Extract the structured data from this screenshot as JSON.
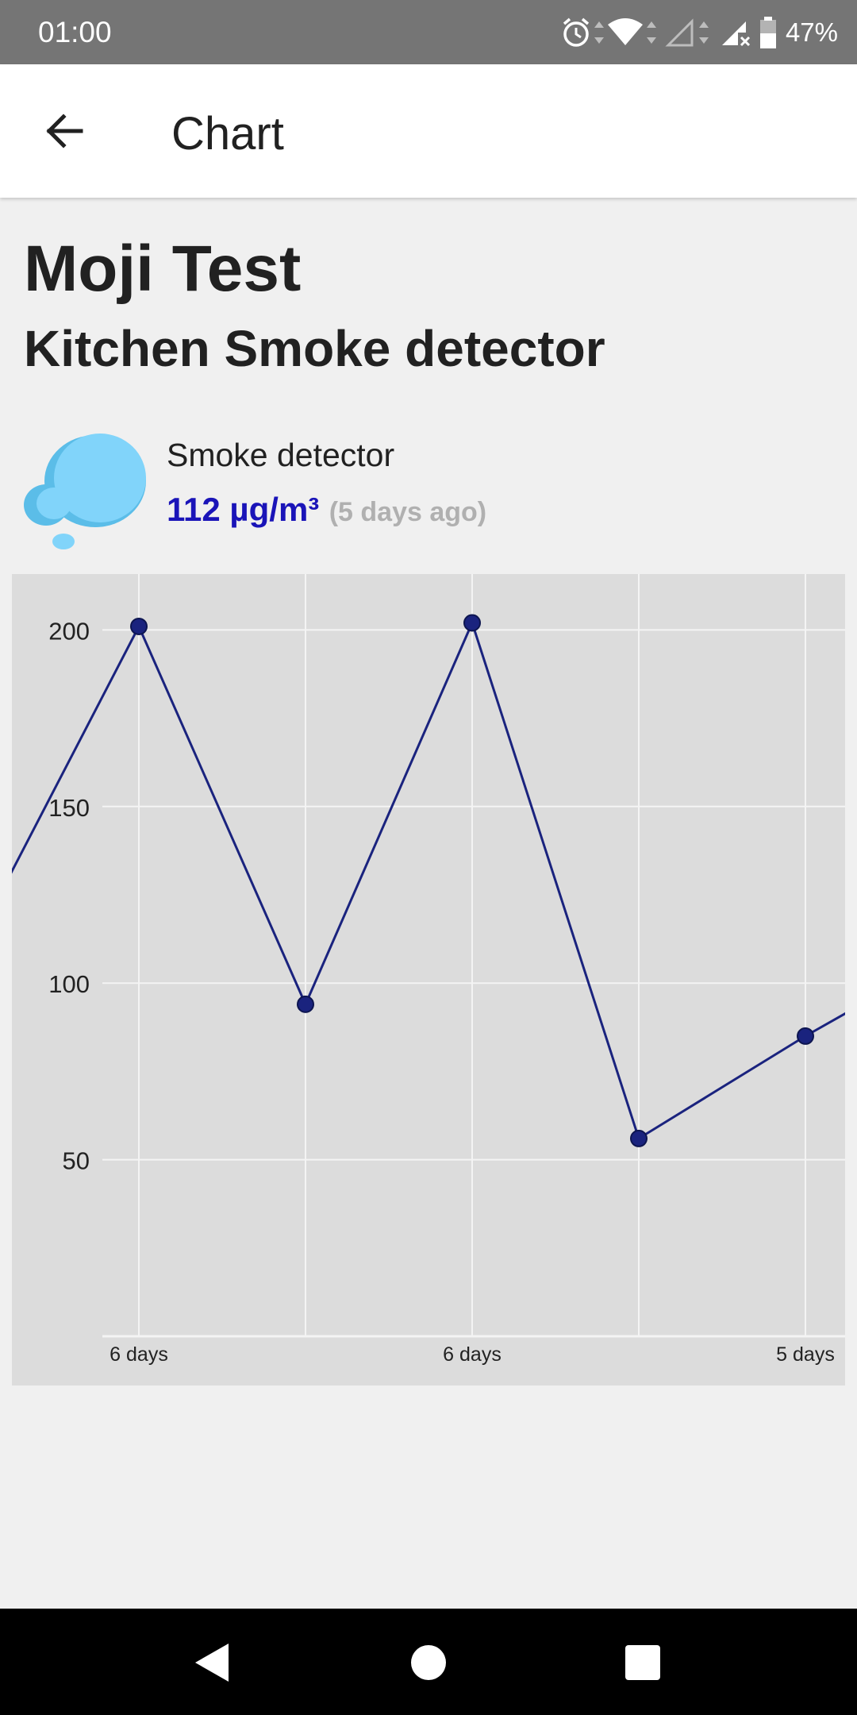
{
  "status_bar": {
    "time": "01:00",
    "battery": "47%"
  },
  "app_bar": {
    "title": "Chart",
    "back_icon": "arrow-back-icon"
  },
  "header": {
    "device": "Moji Test",
    "sensor": "Kitchen Smoke detector"
  },
  "sensor": {
    "icon": "cloud-bubble-icon",
    "type": "Smoke detector",
    "value": "112 µg/m³",
    "age": "(5 days ago)"
  },
  "colors": {
    "accent": "#1a14b8",
    "series": "#1a237e",
    "chart_bg": "#dcdcdc",
    "icon": "#7fd3f7"
  },
  "chart_data": {
    "type": "line",
    "y_ticks": [
      200,
      150,
      100,
      50
    ],
    "ylim": [
      0,
      215
    ],
    "x_ticks": [
      {
        "pos": 1,
        "label": "6 days"
      },
      {
        "pos": 2,
        "label": ""
      },
      {
        "pos": 3,
        "label": "6 days"
      },
      {
        "pos": 4,
        "label": ""
      },
      {
        "pos": 5,
        "label": "5 days"
      }
    ],
    "xlim": [
      0.11,
      5.3
    ],
    "points": [
      {
        "x": 0.11,
        "y": 120,
        "marker": false
      },
      {
        "x": 1,
        "y": 201,
        "marker": true
      },
      {
        "x": 2,
        "y": 94,
        "marker": true
      },
      {
        "x": 3,
        "y": 202,
        "marker": true
      },
      {
        "x": 4,
        "y": 56,
        "marker": true
      },
      {
        "x": 5,
        "y": 85,
        "marker": true
      },
      {
        "x": 5.3,
        "y": 93,
        "marker": false
      }
    ],
    "grid": true
  }
}
